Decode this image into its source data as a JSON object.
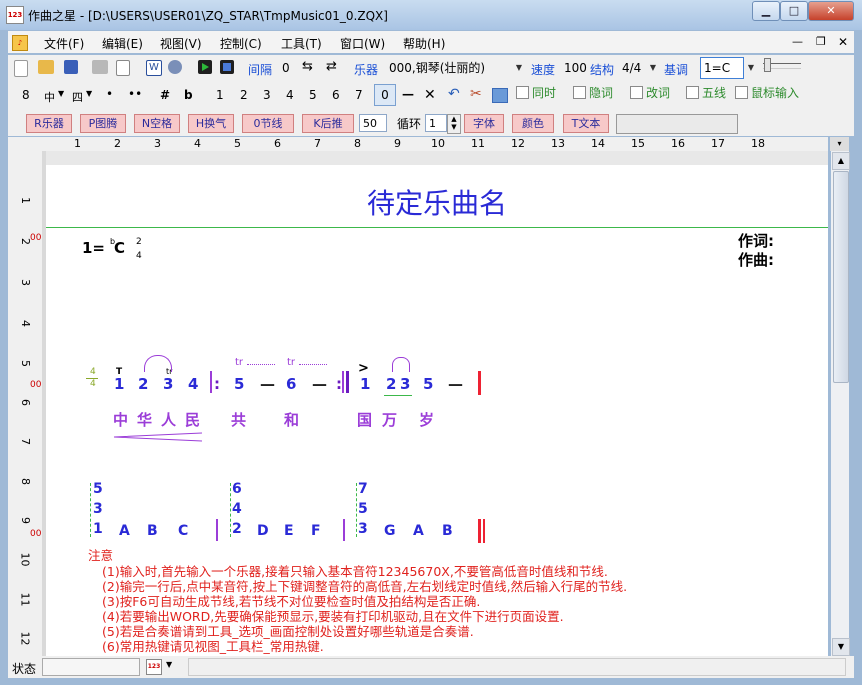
{
  "window": {
    "title": "作曲之星 - [D:\\USERS\\USER01\\ZQ_STAR\\TmpMusic01_0.ZQX]",
    "app_icon_text": "123"
  },
  "menu": [
    "文件(F)",
    "编辑(E)",
    "视图(V)",
    "控制(C)",
    "工具(T)",
    "窗口(W)",
    "帮助(H)"
  ],
  "toolbar1": {
    "interval_label": "间隔",
    "interval_value": "0",
    "instrument_label": "乐器",
    "instrument_value": "000,钢琴(壮丽的)",
    "speed_label": "速度",
    "speed_value": "100",
    "structure_label": "结构",
    "structure_value": "4/4",
    "key_label": "基调",
    "key_value": "1=C"
  },
  "toolbar2": {
    "items": [
      "8",
      "中",
      "四",
      "•",
      "••",
      "#",
      "b",
      "1",
      "2",
      "3",
      "4",
      "5",
      "6",
      "7",
      "0",
      "—",
      "✕"
    ],
    "checkboxes": [
      "同时",
      "隐词",
      "改词",
      "五线",
      "鼠标输入"
    ]
  },
  "toolbar3": {
    "buttons": [
      "R乐器",
      "P图腾",
      "N空格",
      "H换气",
      "0节线",
      "K后推"
    ],
    "width_value": "50",
    "loop_label": "循环",
    "loop_value": "1",
    "buttons2": [
      "字体",
      "颜色",
      "T文本"
    ]
  },
  "ruler_h": [
    "1",
    "2",
    "3",
    "4",
    "5",
    "6",
    "7",
    "8",
    "9",
    "10",
    "11",
    "12",
    "13",
    "14",
    "15",
    "16",
    "17",
    "18"
  ],
  "ruler_v": [
    "1",
    "2",
    "3",
    "4",
    "5",
    "6",
    "7",
    "8",
    "9",
    "10",
    "11",
    "12"
  ],
  "track_labels": [
    "000",
    "001",
    "002"
  ],
  "doc": {
    "title": "待定乐曲名",
    "key_sig": "1=",
    "key_note": "C",
    "key_flat": "b",
    "time_top": "2",
    "time_bottom": "4",
    "lyricist_label": "作词:",
    "composer_label": "作曲:",
    "melody_time_top": "4",
    "melody_time_bottom": "4",
    "melody_notes": [
      "1",
      "2",
      "3",
      "4",
      "5",
      "—",
      "6",
      "—",
      "1",
      "2",
      "3",
      "5",
      "—"
    ],
    "trill_marks": [
      "tr",
      "tr"
    ],
    "accent_mark": ">",
    "lyrics": [
      "中",
      "华",
      "人",
      "民",
      "共",
      "和",
      "国",
      "万",
      "岁"
    ],
    "chords": [
      {
        "stack": [
          "5",
          "3",
          "1"
        ],
        "notes": [
          "A",
          "B",
          "C"
        ]
      },
      {
        "stack": [
          "6",
          "4",
          "2"
        ],
        "notes": [
          "D",
          "E",
          "F"
        ]
      },
      {
        "stack": [
          "7",
          "5",
          "3"
        ],
        "notes": [
          "G",
          "A",
          "B"
        ]
      }
    ],
    "notes_heading": "注意",
    "notes": [
      "(1)输入时,首先输入一个乐器,接着只输入基本音符12345670X,不要管高低音时值线和节线.",
      "(2)输完一行后,点中某音符,按上下键调整音符的高低音,左右划线定时值线,然后输入行尾的节线.",
      "(3)按F6可自动生成节线,若节线不对位要检查时值及拍结构是否正确.",
      "(4)若要输出WORD,先要确保能预显示,要装有打印机驱动,且在文件下进行页面设置.",
      "(5)若是合奏谱请到工具_选项_画面控制处设置好哪些轨道是合奏谱.",
      "(6)常用热键请见视图_工具栏_常用热键."
    ]
  },
  "status": {
    "label": "状态"
  },
  "colors": {
    "accent_blue": "#2a2ad6",
    "lyric_purple": "#9b3dd8",
    "note_red": "#e0221e",
    "line_green": "#3cb84a"
  }
}
